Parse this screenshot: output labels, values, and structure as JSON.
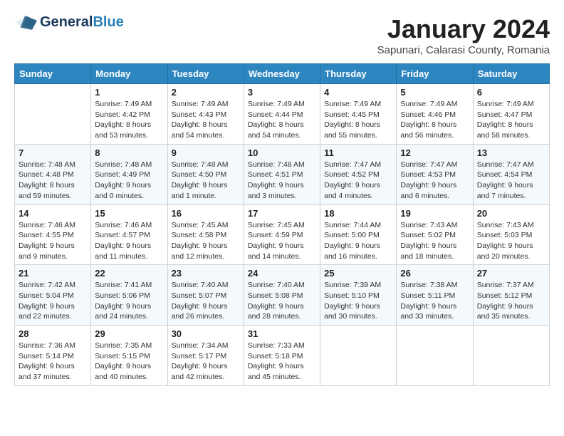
{
  "header": {
    "logo_general": "General",
    "logo_blue": "Blue",
    "month": "January 2024",
    "location": "Sapunari, Calarasi County, Romania"
  },
  "days_of_week": [
    "Sunday",
    "Monday",
    "Tuesday",
    "Wednesday",
    "Thursday",
    "Friday",
    "Saturday"
  ],
  "weeks": [
    [
      {
        "day": "",
        "info": ""
      },
      {
        "day": "1",
        "info": "Sunrise: 7:49 AM\nSunset: 4:42 PM\nDaylight: 8 hours\nand 53 minutes."
      },
      {
        "day": "2",
        "info": "Sunrise: 7:49 AM\nSunset: 4:43 PM\nDaylight: 8 hours\nand 54 minutes."
      },
      {
        "day": "3",
        "info": "Sunrise: 7:49 AM\nSunset: 4:44 PM\nDaylight: 8 hours\nand 54 minutes."
      },
      {
        "day": "4",
        "info": "Sunrise: 7:49 AM\nSunset: 4:45 PM\nDaylight: 8 hours\nand 55 minutes."
      },
      {
        "day": "5",
        "info": "Sunrise: 7:49 AM\nSunset: 4:46 PM\nDaylight: 8 hours\nand 56 minutes."
      },
      {
        "day": "6",
        "info": "Sunrise: 7:49 AM\nSunset: 4:47 PM\nDaylight: 8 hours\nand 58 minutes."
      }
    ],
    [
      {
        "day": "7",
        "info": "Sunrise: 7:48 AM\nSunset: 4:48 PM\nDaylight: 8 hours\nand 59 minutes."
      },
      {
        "day": "8",
        "info": "Sunrise: 7:48 AM\nSunset: 4:49 PM\nDaylight: 9 hours\nand 0 minutes."
      },
      {
        "day": "9",
        "info": "Sunrise: 7:48 AM\nSunset: 4:50 PM\nDaylight: 9 hours\nand 1 minute."
      },
      {
        "day": "10",
        "info": "Sunrise: 7:48 AM\nSunset: 4:51 PM\nDaylight: 9 hours\nand 3 minutes."
      },
      {
        "day": "11",
        "info": "Sunrise: 7:47 AM\nSunset: 4:52 PM\nDaylight: 9 hours\nand 4 minutes."
      },
      {
        "day": "12",
        "info": "Sunrise: 7:47 AM\nSunset: 4:53 PM\nDaylight: 9 hours\nand 6 minutes."
      },
      {
        "day": "13",
        "info": "Sunrise: 7:47 AM\nSunset: 4:54 PM\nDaylight: 9 hours\nand 7 minutes."
      }
    ],
    [
      {
        "day": "14",
        "info": "Sunrise: 7:46 AM\nSunset: 4:55 PM\nDaylight: 9 hours\nand 9 minutes."
      },
      {
        "day": "15",
        "info": "Sunrise: 7:46 AM\nSunset: 4:57 PM\nDaylight: 9 hours\nand 11 minutes."
      },
      {
        "day": "16",
        "info": "Sunrise: 7:45 AM\nSunset: 4:58 PM\nDaylight: 9 hours\nand 12 minutes."
      },
      {
        "day": "17",
        "info": "Sunrise: 7:45 AM\nSunset: 4:59 PM\nDaylight: 9 hours\nand 14 minutes."
      },
      {
        "day": "18",
        "info": "Sunrise: 7:44 AM\nSunset: 5:00 PM\nDaylight: 9 hours\nand 16 minutes."
      },
      {
        "day": "19",
        "info": "Sunrise: 7:43 AM\nSunset: 5:02 PM\nDaylight: 9 hours\nand 18 minutes."
      },
      {
        "day": "20",
        "info": "Sunrise: 7:43 AM\nSunset: 5:03 PM\nDaylight: 9 hours\nand 20 minutes."
      }
    ],
    [
      {
        "day": "21",
        "info": "Sunrise: 7:42 AM\nSunset: 5:04 PM\nDaylight: 9 hours\nand 22 minutes."
      },
      {
        "day": "22",
        "info": "Sunrise: 7:41 AM\nSunset: 5:06 PM\nDaylight: 9 hours\nand 24 minutes."
      },
      {
        "day": "23",
        "info": "Sunrise: 7:40 AM\nSunset: 5:07 PM\nDaylight: 9 hours\nand 26 minutes."
      },
      {
        "day": "24",
        "info": "Sunrise: 7:40 AM\nSunset: 5:08 PM\nDaylight: 9 hours\nand 28 minutes."
      },
      {
        "day": "25",
        "info": "Sunrise: 7:39 AM\nSunset: 5:10 PM\nDaylight: 9 hours\nand 30 minutes."
      },
      {
        "day": "26",
        "info": "Sunrise: 7:38 AM\nSunset: 5:11 PM\nDaylight: 9 hours\nand 33 minutes."
      },
      {
        "day": "27",
        "info": "Sunrise: 7:37 AM\nSunset: 5:12 PM\nDaylight: 9 hours\nand 35 minutes."
      }
    ],
    [
      {
        "day": "28",
        "info": "Sunrise: 7:36 AM\nSunset: 5:14 PM\nDaylight: 9 hours\nand 37 minutes."
      },
      {
        "day": "29",
        "info": "Sunrise: 7:35 AM\nSunset: 5:15 PM\nDaylight: 9 hours\nand 40 minutes."
      },
      {
        "day": "30",
        "info": "Sunrise: 7:34 AM\nSunset: 5:17 PM\nDaylight: 9 hours\nand 42 minutes."
      },
      {
        "day": "31",
        "info": "Sunrise: 7:33 AM\nSunset: 5:18 PM\nDaylight: 9 hours\nand 45 minutes."
      },
      {
        "day": "",
        "info": ""
      },
      {
        "day": "",
        "info": ""
      },
      {
        "day": "",
        "info": ""
      }
    ]
  ]
}
